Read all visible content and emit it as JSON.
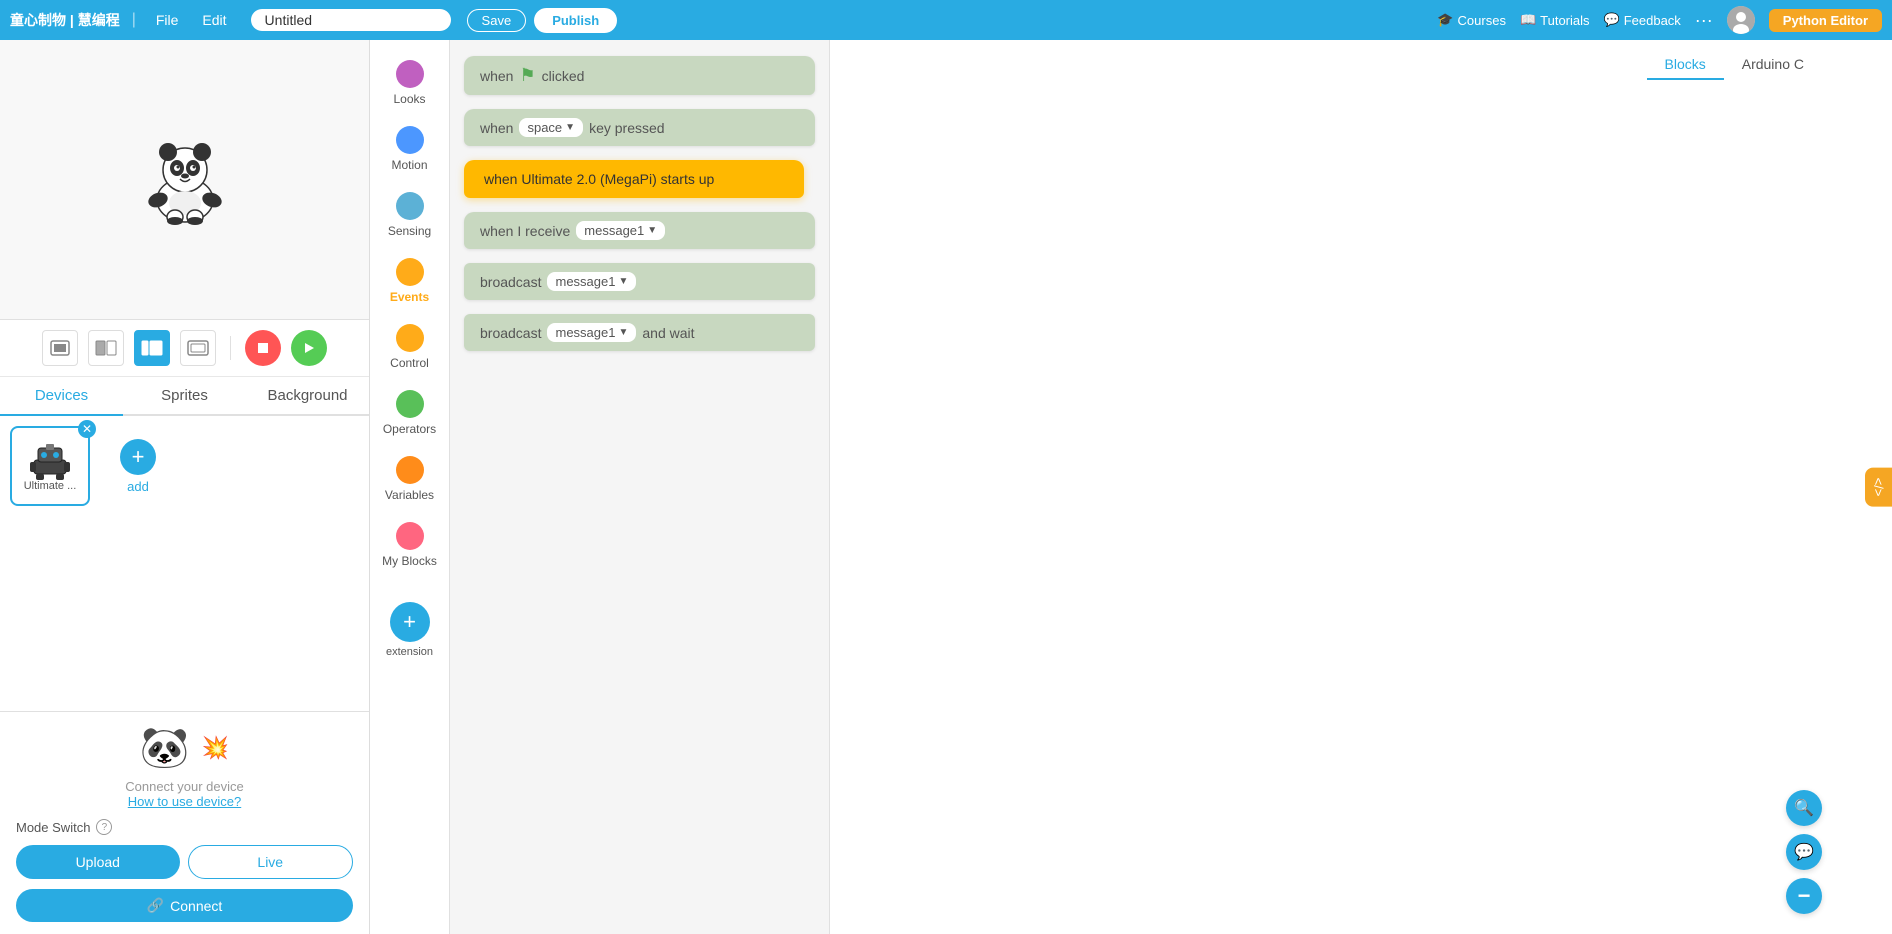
{
  "topnav": {
    "brand": "童心制物 | 慧编程",
    "file_label": "File",
    "edit_label": "Edit",
    "title_value": "Untitled",
    "save_label": "Save",
    "publish_label": "Publish",
    "courses_label": "Courses",
    "tutorials_label": "Tutorials",
    "feedback_label": "Feedback",
    "python_editor_label": "Python Editor"
  },
  "left_panel": {
    "tabs": [
      "Devices",
      "Sprites",
      "Background"
    ],
    "active_tab": "Devices",
    "device_name": "Ultimate ...",
    "add_label": "add",
    "connect_text": "Connect your device",
    "how_to_label": "How to use device?",
    "mode_switch_label": "Mode Switch",
    "upload_label": "Upload",
    "live_label": "Live",
    "connect_label": "Connect"
  },
  "block_categories": [
    {
      "id": "looks",
      "label": "Looks",
      "color": "#c060c0",
      "active": false
    },
    {
      "id": "motion",
      "label": "Motion",
      "color": "#4c97ff",
      "active": false
    },
    {
      "id": "sensing",
      "label": "Sensing",
      "color": "#5cb1d6",
      "active": false
    },
    {
      "id": "events",
      "label": "Events",
      "color": "#ffab19",
      "active": true
    },
    {
      "id": "control",
      "label": "Control",
      "color": "#ffab19",
      "active": false
    },
    {
      "id": "operators",
      "label": "Operators",
      "color": "#59c059",
      "active": false
    },
    {
      "id": "variables",
      "label": "Variables",
      "color": "#ff8c1a",
      "active": false
    },
    {
      "id": "myblocks",
      "label": "My Blocks",
      "color": "#ff6680",
      "active": false
    }
  ],
  "extension_label": "extension",
  "blocks": [
    {
      "id": "when_flag",
      "type": "hat",
      "text": "when 🚩 clicked"
    },
    {
      "id": "when_key",
      "type": "hat",
      "text": "when  space ▾  key pressed"
    },
    {
      "id": "when_starts_up",
      "type": "hat_orange",
      "text": "when Ultimate 2.0 (MegaPi)  starts up"
    },
    {
      "id": "when_receive",
      "type": "hat",
      "text": "when I receive  message1 ▾ "
    },
    {
      "id": "broadcast",
      "type": "stack",
      "text": "broadcast  message1 ▾ "
    },
    {
      "id": "broadcast_wait",
      "type": "stack",
      "text": "broadcast  message1 ▾   and wait"
    }
  ],
  "canvas_tabs": {
    "blocks_label": "Blocks",
    "arduino_label": "Arduino C",
    "active": "Blocks"
  },
  "zoom": {
    "in_icon": "+",
    "chat_icon": "💬",
    "minus_icon": "−"
  },
  "code_toggle": "</>",
  "icons": {
    "stage_small": "⬜",
    "stage_medium": "⬜",
    "stage_large": "⬛",
    "stage_full": "⬜",
    "stop": "■",
    "go": "▶",
    "link": "🔗",
    "search": "🔍"
  }
}
